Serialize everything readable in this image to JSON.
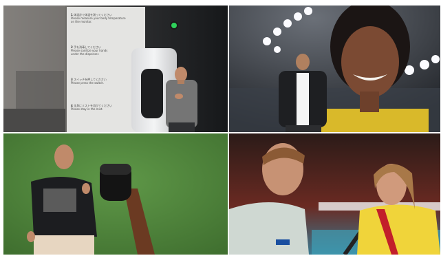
{
  "layout": "2x2 video collage",
  "panels": [
    {
      "id": "top-left",
      "scene": "presenter in grey shirt beside wall-mounted sanitizer dispenser and instruction sign",
      "sign_steps": [
        {
          "num": "1",
          "text": "体温計で体温を測ってください\nPlease measure your body temperature\non the monitor."
        },
        {
          "num": "2",
          "text": "手を消毒してください\nPlease sanitize your hands\nunder the dispenser."
        },
        {
          "num": "3",
          "text": "スイッチを押してください\nPlease press the switch."
        },
        {
          "num": "4",
          "text": "全身にミストを浴びてください\nPlease stay in the mist."
        }
      ]
    },
    {
      "id": "top-right",
      "scene": "presenter in black jacket in front of large screen showing smiling athlete in arena"
    },
    {
      "id": "bottom-left",
      "scene": "presenter in black sweatshirt gesturing before green screen with raised fist image"
    },
    {
      "id": "bottom-right",
      "scene": "interviewer in light shirt speaking with female volleyball player with medal in arena"
    }
  ],
  "colors": {
    "indicator_green": "#2ed15a",
    "green_screen": "#4f8a3c",
    "jersey_yellow": "#f0d43a"
  }
}
